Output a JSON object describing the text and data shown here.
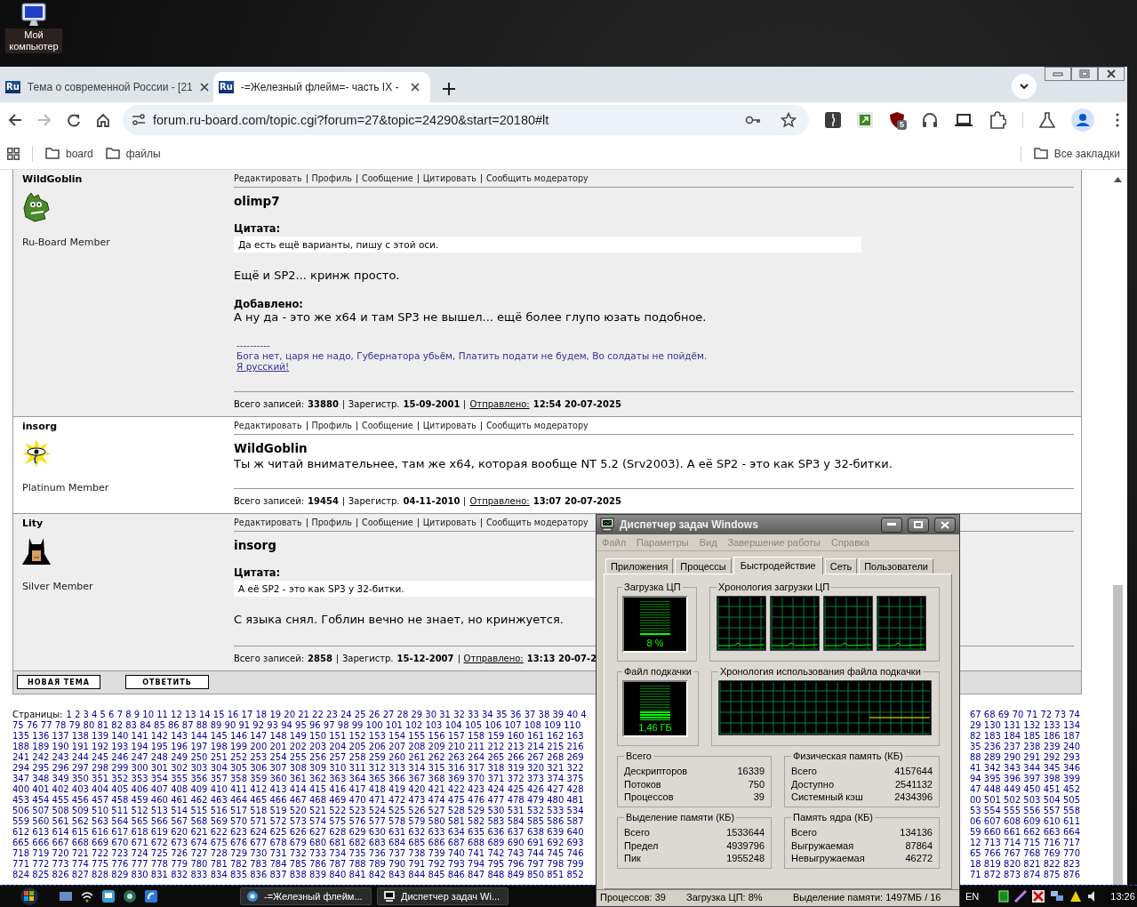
{
  "desktop": {
    "icon_label": "Мой компьютер"
  },
  "browser": {
    "tabs": [
      {
        "favicon": "Ru",
        "title": "Тема о современной России - [21",
        "selected": false
      },
      {
        "favicon": "Ru",
        "title": "-=Железный флейм=- часть IX -",
        "selected": true
      }
    ],
    "forward_disabled": true,
    "url": "forum.ru-board.com/topic.cgi?forum=27&topic=24290&start=20180#lt",
    "extension_badge": "5",
    "bookmarks": [
      "board",
      "файлы"
    ],
    "all_bookmarks": "Все закладки"
  },
  "forum": {
    "posts": [
      {
        "author": "WildGoblin",
        "avatar": {
          "kind": "goblin"
        },
        "rank": "Ru-Board Member",
        "shade": true,
        "actions": [
          "Редактировать",
          "Профиль",
          "Сообщение",
          "Цитировать",
          "Сообщить модератору"
        ],
        "addressee": "olimp7",
        "quote_label": "Цитата:",
        "quote": "Да есть ещё варианты, пишу с этой оси.",
        "body": "Ещё и SP2... кринж просто.",
        "added_label": "Добавлено:",
        "added": "А ну да - это же x64 и там SP3 не вышел... ещё более глупо юзать подобное.",
        "signature": {
          "rule": "----------",
          "text": "Бога нет, царя не надо, Губернатора убьём, Платить подати не будем, Во солдаты не пойдём.",
          "link": "Я русский!"
        },
        "footer": {
          "posts_label": "Всего записей:",
          "posts": "33880",
          "reg_label": "Зарегистр.",
          "reg": "15-09-2001",
          "sent_label": "Отправлено:",
          "sent": "12:54 20-07-2025"
        }
      },
      {
        "author": "insorg",
        "avatar": {
          "kind": "sun"
        },
        "rank": "Platinum Member",
        "shade": false,
        "actions": [
          "Редактировать",
          "Профиль",
          "Сообщение",
          "Цитировать",
          "Сообщить модератору"
        ],
        "addressee": "WildGoblin",
        "body": "Ты ж читай внимательнее, там же x64, которая вообще NT 5.2 (Srv2003). А её SP2 - это как SP3 у 32-битки.",
        "footer": {
          "posts_label": "Всего записей:",
          "posts": "19454",
          "reg_label": "Зарегистр.",
          "reg": "04-11-2010",
          "sent_label": "Отправлено:",
          "sent": "13:07 20-07-2025"
        }
      },
      {
        "author": "Lity",
        "avatar": {
          "kind": "bat"
        },
        "rank": "Silver Member",
        "shade": true,
        "actions": [
          "Редактировать",
          "Профиль",
          "Сообщение",
          "Цитировать",
          "Сообщить модератору"
        ],
        "addressee": "insorg",
        "quote_label": "Цитата:",
        "quote": "А её SP2 - это как SP3 у 32-битки.",
        "body": "С языка снял. Гоблин вечно не знает, но кринжуется.",
        "footer": {
          "posts_label": "Всего записей:",
          "posts": "2858",
          "reg_label": "Зарегистр.",
          "reg": "15-12-2007",
          "sent_label": "Отправлено:",
          "sent": "13:13 20-07-2"
        }
      }
    ],
    "buttons": [
      "НОВАЯ ТЕМА",
      "ОТВЕТИТЬ"
    ],
    "pages_label": "Страницы:",
    "page_lines": [
      {
        "left": "1 2 3 4 5 6 7 8 9 10 11 12 13 14 15 16 17 18 19 20 21 22 23 24 25 26 27 28 29 30 31 32 33 34 35 36 37 38 39 40 4",
        "right": "67 68 69 70 71 72 73 74"
      },
      {
        "left": "75 76 77 78 79 80 81 82 83 84 85 86 87 88 89 90 91 92 93 94 95 96 97 98 99 100 101 102 103 104 105 106 107 108 109 110",
        "right": "29 130 131 132 133 134"
      },
      {
        "left": "135 136 137 138 139 140 141 142 143 144 145 146 147 148 149 150 151 152 153 154 155 156 157 158 159 160 161 162 163",
        "right": "82 183 184 185 186 187"
      },
      {
        "left": "188 189 190 191 192 193 194 195 196 197 198 199 200 201 202 203 204 205 206 207 208 209 210 211 212 213 214 215 216",
        "right": "35 236 237 238 239 240"
      },
      {
        "left": "241 242 243 244 245 246 247 248 249 250 251 252 253 254 255 256 257 258 259 260 261 262 263 264 265 266 267 268 269",
        "right": "88 289 290 291 292 293"
      },
      {
        "left": "294 295 296 297 298 299 300 301 302 303 304 305 306 307 308 309 310 311 312 313 314 315 316 317 318 319 320 321 322",
        "right": "41 342 343 344 345 346"
      },
      {
        "left": "347 348 349 350 351 352 353 354 355 356 357 358 359 360 361 362 363 364 365 366 367 368 369 370 371 372 373 374 375",
        "right": "94 395 396 397 398 399"
      },
      {
        "left": "400 401 402 403 404 405 406 407 408 409 410 411 412 413 414 415 416 417 418 419 420 421 422 423 424 425 426 427 428",
        "right": "47 448 449 450 451 452"
      },
      {
        "left": "453 454 455 456 457 458 459 460 461 462 463 464 465 466 467 468 469 470 471 472 473 474 475 476 477 478 479 480 481",
        "right": "00 501 502 503 504 505"
      },
      {
        "left": "506 507 508 509 510 511 512 513 514 515 516 517 518 519 520 521 522 523 524 525 526 527 528 529 530 531 532 533 534",
        "right": "53 554 555 556 557 558"
      },
      {
        "left": "559 560 561 562 563 564 565 566 567 568 569 570 571 572 573 574 575 576 577 578 579 580 581 582 583 584 585 586 587",
        "right": "06 607 608 609 610 611"
      },
      {
        "left": "612 613 614 615 616 617 618 619 620 621 622 623 624 625 626 627 628 629 630 631 632 633 634 635 636 637 638 639 640",
        "right": "59 660 661 662 663 664"
      },
      {
        "left": "665 666 667 668 669 670 671 672 673 674 675 676 677 678 679 680 681 682 683 684 685 686 687 688 689 690 691 692 693",
        "right": "12 713 714 715 716 717"
      },
      {
        "left": "718 719 720 721 722 723 724 725 726 727 728 729 730 731 732 733 734 735 736 737 738 739 740 741 742 743 744 745 746",
        "right": "65 766 767 768 769 770"
      },
      {
        "left": "771 772 773 774 775 776 777 778 779 780 781 782 783 784 785 786 787 788 789 790 791 792 793 794 795 796 797 798 799",
        "right": "18 819 820 821 822 823"
      },
      {
        "left": "824 825 826 827 828 829 830 831 832 833 834 835 836 837 838 839 840 841 842 843 844 845 846 847 848 849 850 851 852",
        "right": "71 872 873 874 875 876"
      }
    ]
  },
  "task_manager": {
    "title": "Диспетчер задач Windows",
    "menu": [
      "Файл",
      "Параметры",
      "Вид",
      "Завершение работы",
      "Справка"
    ],
    "tabs": [
      {
        "label": "Приложения",
        "selected": false
      },
      {
        "label": "Процессы",
        "selected": false
      },
      {
        "label": "Быстродействие",
        "selected": true
      },
      {
        "label": "Сеть",
        "selected": false
      },
      {
        "label": "Пользователи",
        "selected": false
      }
    ],
    "cpu": {
      "title": "Загрузка ЦП",
      "reading": "8 %",
      "level": 0.08
    },
    "cpu_history": {
      "title": "Хронология загрузки ЦП"
    },
    "pagefile": {
      "title": "Файл подкачки",
      "reading": "1,46 ГБ",
      "level": 0.25
    },
    "pagefile_history": {
      "title": "Хронология использования файла подкачки"
    },
    "stats": [
      {
        "title": "Всего",
        "rows": [
          {
            "label": "Дескрипторов",
            "value": "16339"
          },
          {
            "label": "Потоков",
            "value": "750"
          },
          {
            "label": "Процессов",
            "value": "39"
          }
        ]
      },
      {
        "title": "Физическая память (КБ)",
        "rows": [
          {
            "label": "Всего",
            "value": "4157644"
          },
          {
            "label": "Доступно",
            "value": "2541132"
          },
          {
            "label": "Системный кэш",
            "value": "2434396"
          }
        ]
      },
      {
        "title": "Выделение памяти (КБ)",
        "rows": [
          {
            "label": "Всего",
            "value": "1533644"
          },
          {
            "label": "Предел",
            "value": "4939796"
          },
          {
            "label": "Пик",
            "value": "1955248"
          }
        ]
      },
      {
        "title": "Память ядра (КБ)",
        "rows": [
          {
            "label": "Всего",
            "value": "134136"
          },
          {
            "label": "Выгружаемая",
            "value": "87864"
          },
          {
            "label": "Невыгружаемая",
            "value": "46272"
          }
        ]
      }
    ],
    "status": [
      "Процессов: 39",
      "Загрузка ЦП: 8%",
      "Выделение памяти: 1497МБ / 16"
    ]
  },
  "taskbar": {
    "tasks": [
      {
        "kind": "browser",
        "label": "-=Железный флейм..."
      },
      {
        "kind": "monitor",
        "label": "Диспетчер задач Wi..."
      }
    ],
    "language": "EN",
    "clock": "13:26"
  }
}
